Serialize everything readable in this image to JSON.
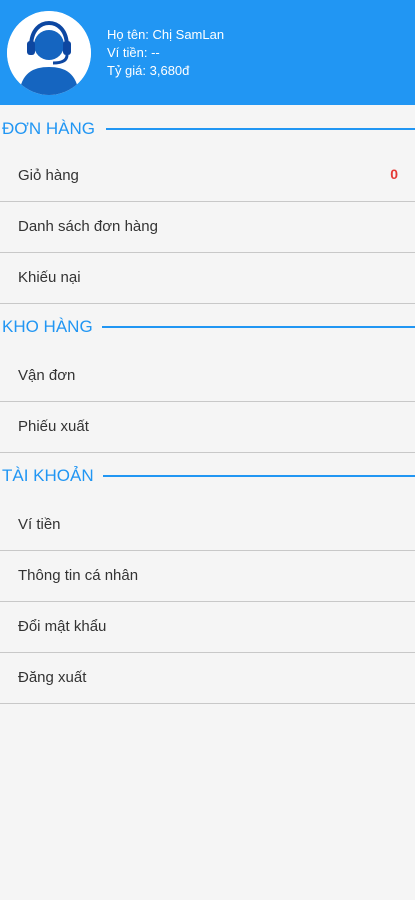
{
  "header": {
    "name_line": "Họ tên: Chị SamLan",
    "wallet_line": "Ví tiền: --",
    "rate_line": "Tỷ giá: 3,680đ",
    "avatar_icon": "support-agent-icon"
  },
  "colors": {
    "primary": "#2196f3",
    "badge": "#e53935",
    "background": "#f5f5f5"
  },
  "sections": {
    "orders": {
      "title": "ĐƠN HÀNG",
      "items": {
        "cart": {
          "label": "Giỏ hàng",
          "badge": "0"
        },
        "order_list": {
          "label": "Danh sách đơn hàng"
        },
        "complaints": {
          "label": "Khiếu nại"
        }
      }
    },
    "warehouse": {
      "title": "KHO HÀNG",
      "items": {
        "waybill": {
          "label": "Vận đơn"
        },
        "export_slip": {
          "label": "Phiếu xuất"
        }
      }
    },
    "account": {
      "title": "TÀI KHOẢN",
      "items": {
        "wallet": {
          "label": "Ví tiền"
        },
        "profile": {
          "label": "Thông tin cá nhân"
        },
        "change_password": {
          "label": "Đổi mật khẩu"
        },
        "logout": {
          "label": "Đăng xuất"
        }
      }
    }
  }
}
